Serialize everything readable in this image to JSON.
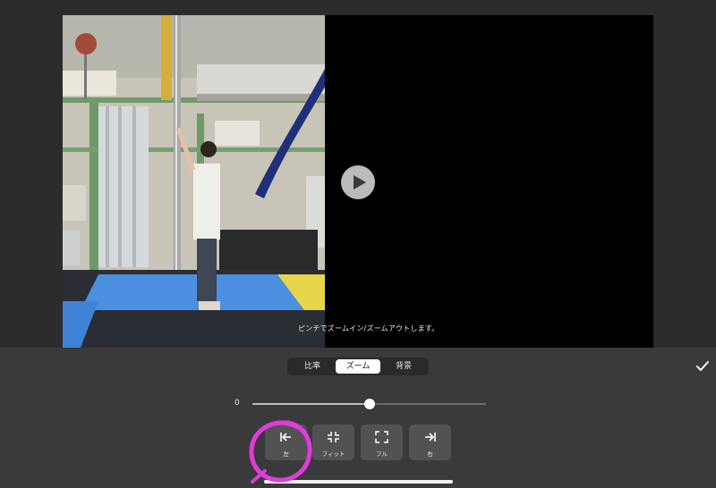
{
  "video": {
    "hint": "ピンチでズームイン/ズームアウトします。"
  },
  "tabs": {
    "items": [
      {
        "label": "比率"
      },
      {
        "label": "ズーム",
        "selected": true
      },
      {
        "label": "背景"
      }
    ]
  },
  "slider": {
    "value_label": "0",
    "level": 0.5
  },
  "position_buttons": [
    {
      "label": "左",
      "icon": "align-left-icon"
    },
    {
      "label": "フィット",
      "icon": "fit-inward-icon"
    },
    {
      "label": "フル",
      "icon": "fullscreen-icon"
    },
    {
      "label": "右",
      "icon": "align-right-icon"
    }
  ],
  "toolbar": {
    "done_icon": "checkmark-icon"
  },
  "colors": {
    "panel": "#3a3a3c",
    "highlight": "#e23bd9"
  }
}
